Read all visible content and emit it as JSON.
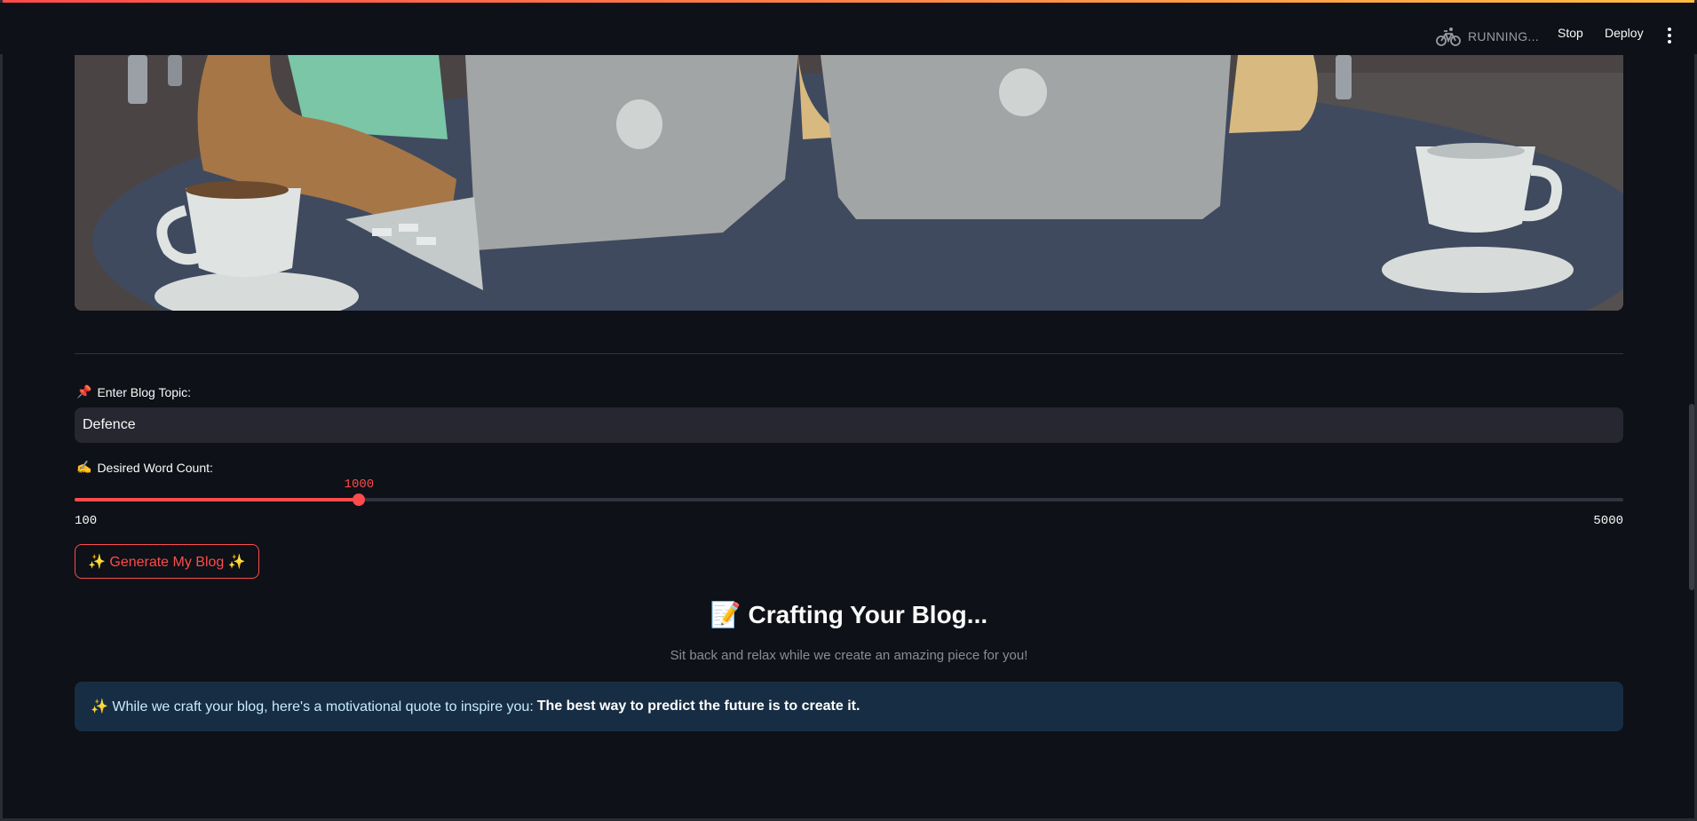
{
  "header": {
    "status_icon": "bicycle-icon",
    "status_text": "RUNNING...",
    "stop_label": "Stop",
    "deploy_label": "Deploy",
    "menu_icon": "kebab-menu-icon"
  },
  "form": {
    "topic_emoji": "📌",
    "topic_label": "Enter Blog Topic:",
    "topic_value": "Defence",
    "count_emoji": "✍️",
    "count_label": "Desired Word Count:",
    "count_value": "1000",
    "count_min": "100",
    "count_max": "5000",
    "count_fraction": 0.1837,
    "generate_label": "✨ Generate My Blog ✨"
  },
  "status_section": {
    "title": "📝 Crafting Your Blog...",
    "subtitle": "Sit back and relax while we create an amazing piece for you!"
  },
  "info": {
    "prefix": "✨ While we craft your blog, here's a motivational quote to inspire you:",
    "quote": "The best way to predict the future is to create it."
  },
  "colors": {
    "accent": "#ff4b4b",
    "background": "#0e1117",
    "input_bg": "#262730",
    "info_bg": "#172d43"
  }
}
